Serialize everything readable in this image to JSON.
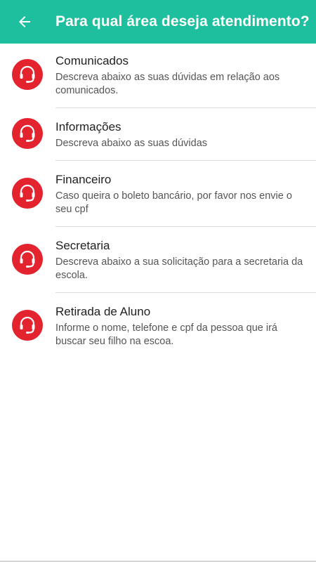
{
  "appbar": {
    "back_icon": "arrow-left-icon",
    "title": "Para qual área deseja atendimento?",
    "color": "#1dbf9f"
  },
  "list": {
    "icon": "headset-icon",
    "icon_color": "#e3232d",
    "items": [
      {
        "title": "Comunicados",
        "description": "Descreva abaixo as suas dúvidas em relação aos comunicados."
      },
      {
        "title": "Informações",
        "description": "Descreva abaixo as suas dúvidas"
      },
      {
        "title": "Financeiro",
        "description": "Caso queira o boleto bancário, por favor nos envie o seu cpf"
      },
      {
        "title": "Secretaria",
        "description": "Descreva abaixo a sua solicitação para a secretaria da escola."
      },
      {
        "title": "Retirada de Aluno",
        "description": "Informe o nome, telefone e cpf da pessoa que irá buscar seu filho na escoa."
      }
    ]
  }
}
